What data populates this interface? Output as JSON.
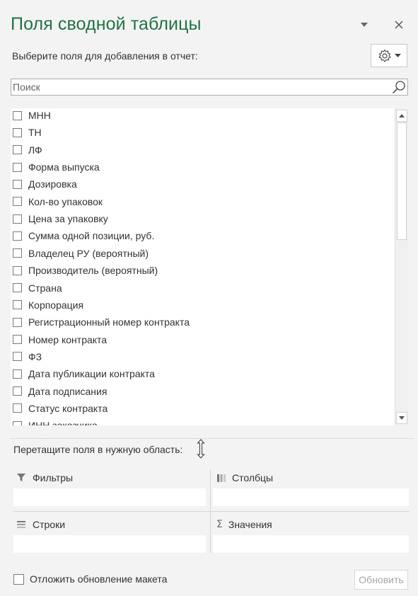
{
  "panel": {
    "title": "Поля сводной таблицы",
    "subtitle": "Выберите поля для добавления в отчет:",
    "dropdown_icon": "triangle-down-icon",
    "close_icon": "close-icon",
    "gear_icon": "gear-icon"
  },
  "search": {
    "placeholder": "Поиск",
    "value": "",
    "icon": "search-icon"
  },
  "fields": [
    {
      "label": "МНН",
      "checked": false
    },
    {
      "label": "ТН",
      "checked": false
    },
    {
      "label": "ЛФ",
      "checked": false
    },
    {
      "label": "Форма выпуска",
      "checked": false
    },
    {
      "label": "Дозировка",
      "checked": false
    },
    {
      "label": "Кол-во упаковок",
      "checked": false
    },
    {
      "label": "Цена за упаковку",
      "checked": false
    },
    {
      "label": "Сумма одной позиции, руб.",
      "checked": false
    },
    {
      "label": "Владелец РУ (вероятный)",
      "checked": false
    },
    {
      "label": "Производитель (вероятный)",
      "checked": false
    },
    {
      "label": "Страна",
      "checked": false
    },
    {
      "label": "Корпорация",
      "checked": false
    },
    {
      "label": "Регистрационный номер контракта",
      "checked": false
    },
    {
      "label": "Номер контракта",
      "checked": false
    },
    {
      "label": "ФЗ",
      "checked": false
    },
    {
      "label": "Дата публикации контракта",
      "checked": false
    },
    {
      "label": "Дата подписания",
      "checked": false
    },
    {
      "label": "Статус контракта",
      "checked": false
    },
    {
      "label": "ИНН заказчика",
      "checked": false
    }
  ],
  "areas": {
    "drag_hint": "Перетащите поля в нужную область:",
    "filters_label": "Фильтры",
    "filters_icon": "filter-icon",
    "columns_label": "Столбцы",
    "columns_icon": "columns-icon",
    "rows_label": "Строки",
    "rows_icon": "rows-icon",
    "values_label": "Значения",
    "values_icon": "sigma-icon"
  },
  "footer": {
    "defer_label": "Отложить обновление макета",
    "defer_checked": false,
    "update_label": "Обновить"
  }
}
